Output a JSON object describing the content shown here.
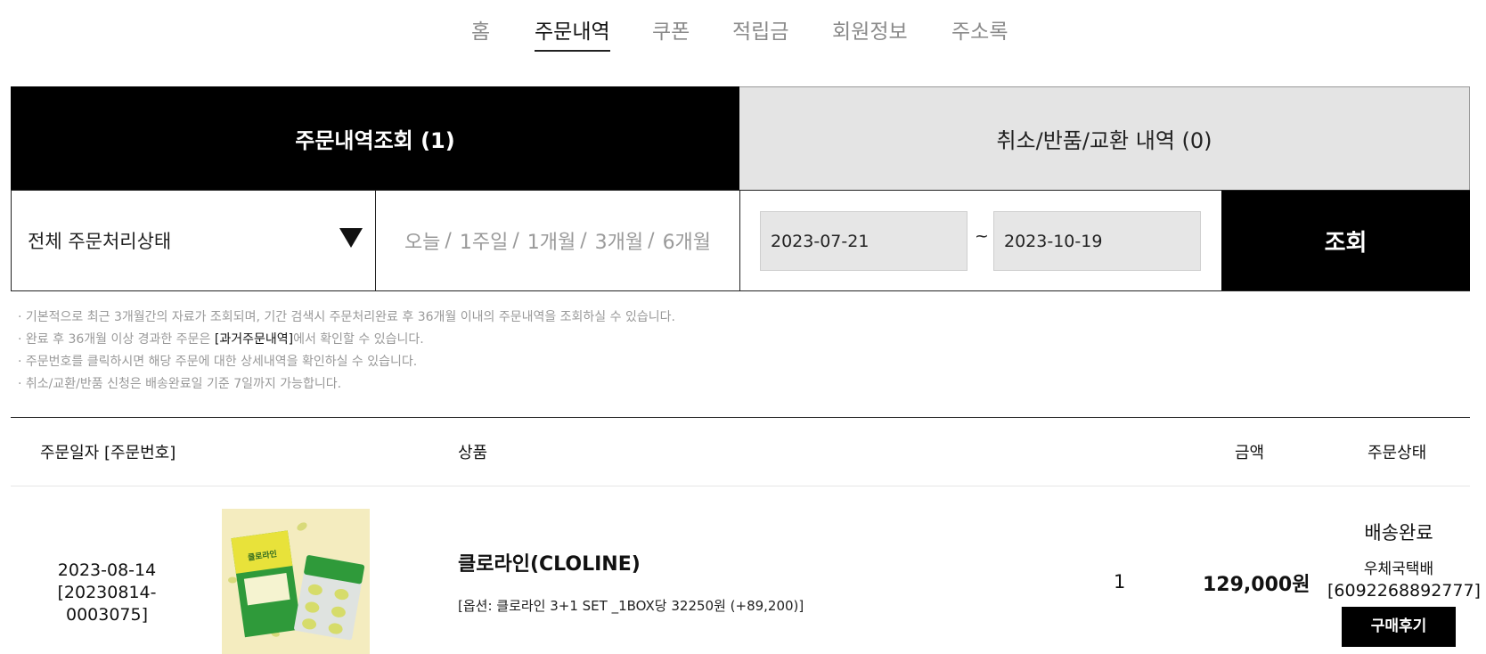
{
  "nav": {
    "items": [
      {
        "label": "홈",
        "active": false
      },
      {
        "label": "주문내역",
        "active": true
      },
      {
        "label": "쿠폰",
        "active": false
      },
      {
        "label": "적립금",
        "active": false
      },
      {
        "label": "회원정보",
        "active": false
      },
      {
        "label": "주소록",
        "active": false
      }
    ]
  },
  "tabs": {
    "orders": "주문내역조회 (1)",
    "cancel": "취소/반품/교환 내역 (0)"
  },
  "filter": {
    "status_select": "전체 주문처리상태",
    "periods": [
      "오늘",
      "1주일",
      "1개월",
      "3개월",
      "6개월"
    ],
    "period_separator": "/",
    "date_from": "2023-07-21",
    "date_separator": "~",
    "date_to": "2023-10-19",
    "search_button": "조회"
  },
  "notices": {
    "line1": "· 기본적으로 최근 3개월간의 자료가 조회되며, 기간 검색시 주문처리완료 후 36개월 이내의 주문내역을 조회하실 수 있습니다.",
    "line2_before": "· 완료 후 36개월 이상 경과한 주문은 ",
    "line2_link": "[과거주문내역]",
    "line2_after": "에서 확인할 수 있습니다.",
    "line3": "· 주문번호를 클릭하시면 해당 주문에 대한 상세내역을 확인하실 수 있습니다.",
    "line4": "· 취소/교환/반품 신청은 배송완료일 기준 7일까지 가능합니다."
  },
  "table": {
    "headers": {
      "order_date": "주문일자 [주문번호]",
      "product": "상품",
      "amount": "금액",
      "status": "주문상태"
    },
    "rows": [
      {
        "date": "2023-08-14",
        "order_no": "[20230814-0003075]",
        "product_name": "클로라인(CLOLINE)",
        "option": "[옵션: 클로라인 3+1 SET _1BOX당 32250원 (+89,200)]",
        "qty": "1",
        "amount": "129,000원",
        "status": "배송완료",
        "courier": "우체국택배",
        "tracking": "[6092268892777]",
        "review_button": "구매후기",
        "thumb_text": "클로라인"
      }
    ]
  },
  "colors": {
    "active_tab_bg": "#000000",
    "inactive_tab_bg": "#e4e4e4",
    "date_bg": "#e6e6e6",
    "muted_text": "#999999",
    "thumb_bg": "#f3e9b6",
    "box_green": "#2f9a3a",
    "box_yellow": "#e8e23a"
  }
}
